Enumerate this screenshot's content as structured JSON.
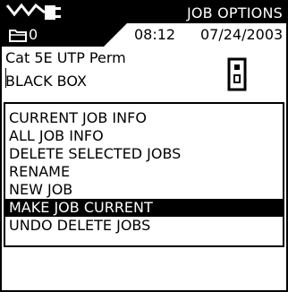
{
  "header": {
    "title": "JOB OPTIONS",
    "logo_icon": "cable-tester-logo-icon"
  },
  "status": {
    "folder_icon": "folder-icon",
    "folder_count": "0",
    "time": "08:12",
    "date": "07/24/2003"
  },
  "job": {
    "cable_type": "Cat 5E UTP Perm",
    "job_name": "BLACK BOX",
    "device_icon": "remote-unit-icon"
  },
  "menu": {
    "items": [
      {
        "label": "CURRENT JOB INFO",
        "selected": false
      },
      {
        "label": "ALL JOB INFO",
        "selected": false
      },
      {
        "label": "DELETE SELECTED JOBS",
        "selected": false
      },
      {
        "label": "RENAME",
        "selected": false
      },
      {
        "label": "NEW JOB",
        "selected": false
      },
      {
        "label": "MAKE JOB CURRENT",
        "selected": true
      },
      {
        "label": "UNDO DELETE JOBS",
        "selected": false
      }
    ]
  },
  "colors": {
    "foreground": "#000000",
    "background": "#ffffff"
  }
}
